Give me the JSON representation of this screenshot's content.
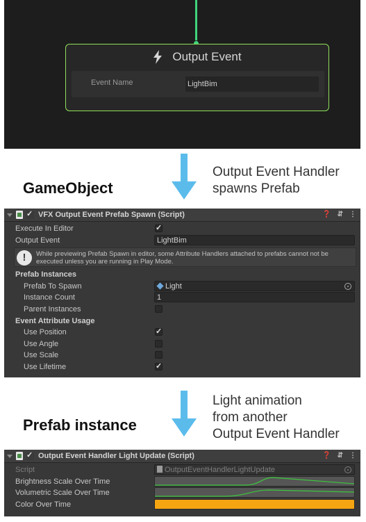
{
  "graph": {
    "node_title": "Output Event",
    "field_label": "Event Name",
    "field_value": "LightBim",
    "link_color": "#3fd47c",
    "node_border_color": "#8ee05a",
    "title_icon": "lightning-icon"
  },
  "section1": {
    "caption_line1": "Output Event Handler",
    "caption_line2": "spawns Prefab",
    "heading": "GameObject",
    "arrow_color": "#5bbcec"
  },
  "inspector1": {
    "title": "VFX Output Event Prefab Spawn (Script)",
    "header_icons": [
      "help-icon",
      "settings-sliders-icon",
      "more-icon"
    ],
    "rows": {
      "execute_in_editor": {
        "label": "Execute In Editor",
        "checked": true
      },
      "output_event": {
        "label": "Output Event",
        "value": "LightBim"
      }
    },
    "warning": "While previewing Prefab Spawn in editor, some Attribute Handlers attached to prefabs cannot not be executed unless you are running in Play Mode.",
    "prefab_section": "Prefab Instances",
    "prefab_to_spawn": {
      "label": "Prefab To Spawn",
      "value": "Light"
    },
    "instance_count": {
      "label": "Instance Count",
      "value": "1"
    },
    "parent_instances": {
      "label": "Parent Instances",
      "checked": false
    },
    "attr_section": "Event Attribute Usage",
    "use_position": {
      "label": "Use Position",
      "checked": true
    },
    "use_angle": {
      "label": "Use Angle",
      "checked": false
    },
    "use_scale": {
      "label": "Use Scale",
      "checked": false
    },
    "use_lifetime": {
      "label": "Use Lifetime",
      "checked": true
    }
  },
  "section2": {
    "caption_line1": "Light animation",
    "caption_line2": "from another",
    "caption_line3": "Output Event Handler",
    "heading": "Prefab instance"
  },
  "inspector2": {
    "title": "Output Event Handler Light Update (Script)",
    "script_label": "Script",
    "script_value": "OutputEventHandlerLightUpdate",
    "brightness_label": "Brightness Scale Over Time",
    "volumetric_label": "Volumetric Scale Over Time",
    "color_label": "Color Over Time",
    "curve_color": "#3cc63c",
    "gradient_color": "#f6a512"
  }
}
